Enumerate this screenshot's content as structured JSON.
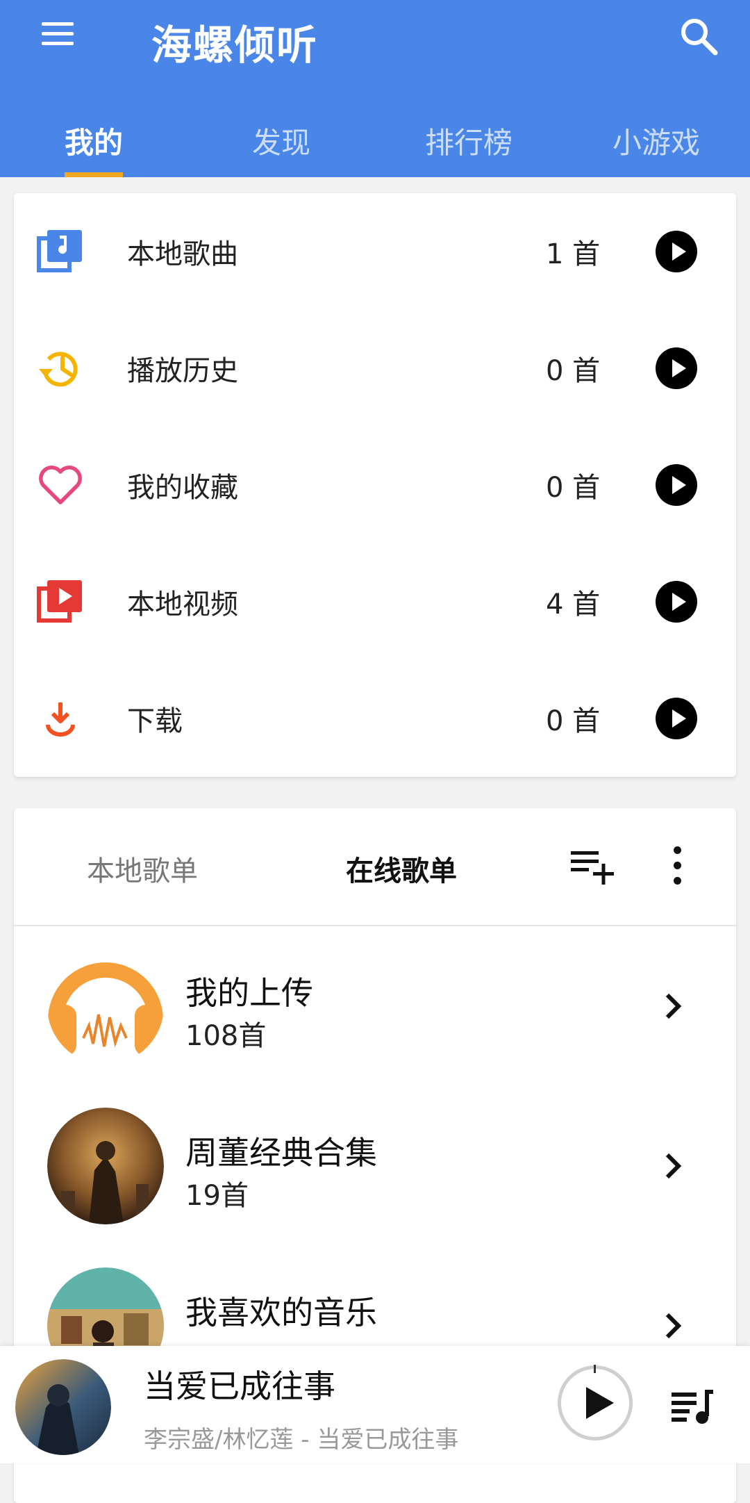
{
  "app": {
    "title": "海螺倾听"
  },
  "tabs": [
    {
      "label": "我的",
      "active": true
    },
    {
      "label": "发现",
      "active": false
    },
    {
      "label": "排行榜",
      "active": false
    },
    {
      "label": "小游戏",
      "active": false
    }
  ],
  "library": {
    "items": [
      {
        "label": "本地歌曲",
        "count": "1 首",
        "icon": "local-music-icon",
        "color": "#4a86e8"
      },
      {
        "label": "播放历史",
        "count": "0 首",
        "icon": "history-icon",
        "color": "#f5b400"
      },
      {
        "label": "我的收藏",
        "count": "0 首",
        "icon": "heart-icon",
        "color": "#e64980"
      },
      {
        "label": "本地视频",
        "count": "4 首",
        "icon": "video-library-icon",
        "color": "#e53935"
      },
      {
        "label": "下载",
        "count": "0 首",
        "icon": "download-icon",
        "color": "#f4511e"
      }
    ]
  },
  "playlists": {
    "tabs": {
      "local": "本地歌单",
      "online": "在线歌单"
    },
    "items": [
      {
        "name": "我的上传",
        "count": "108首"
      },
      {
        "name": "周董经典合集",
        "count": "19首"
      },
      {
        "name": "我喜欢的音乐",
        "count": ""
      }
    ]
  },
  "player": {
    "title": "当爱已成往事",
    "artist": "李宗盛/林忆莲 - 当爱已成往事"
  },
  "colors": {
    "primary": "#4a86e8",
    "tab_indicator": "#f5a623",
    "upload_cover": "#f5a03a"
  }
}
